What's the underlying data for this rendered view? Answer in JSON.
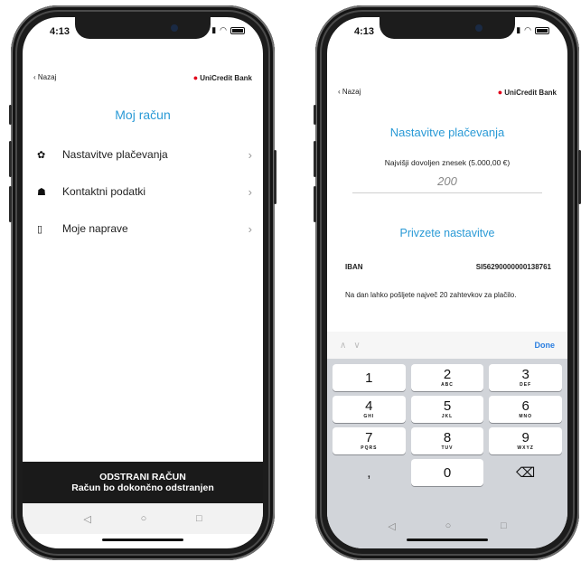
{
  "left": {
    "status_time": "4:13",
    "back": "‹ Nazaj",
    "brand": "UniCredit Bank",
    "title": "Moj račun",
    "menu": [
      {
        "label": "Nastavitve plačevanja",
        "icon": "gear-icon"
      },
      {
        "label": "Kontaktni podatki",
        "icon": "contacts-icon"
      },
      {
        "label": "Moje naprave",
        "icon": "phone-icon"
      }
    ],
    "delete_title": "ODSTRANI RAČUN",
    "delete_subtitle": "Račun bo dokončno odstranjen"
  },
  "right": {
    "status_time": "4:13",
    "back": "‹ Nazaj",
    "brand": "UniCredit Bank",
    "title": "Nastavitve plačevanja",
    "limit_label": "Najvišji dovoljen znesek (5.000,00 €)",
    "limit_value": "200",
    "section_title": "Privzete nastavitve",
    "iban_label": "IBAN",
    "iban_value": "SI56290000000138761",
    "note": "Na dan lahko pošljete največ 20 zahtevkov za plačilo.",
    "keyboard": {
      "done": "Done",
      "keys": [
        {
          "d": "1",
          "l": ""
        },
        {
          "d": "2",
          "l": "ABC"
        },
        {
          "d": "3",
          "l": "DEF"
        },
        {
          "d": "4",
          "l": "GHI"
        },
        {
          "d": "5",
          "l": "JKL"
        },
        {
          "d": "6",
          "l": "MNO"
        },
        {
          "d": "7",
          "l": "PQRS"
        },
        {
          "d": "8",
          "l": "TUV"
        },
        {
          "d": "9",
          "l": "WXYZ"
        },
        {
          "d": ",",
          "l": ""
        },
        {
          "d": "0",
          "l": ""
        },
        {
          "d": "⌫",
          "l": ""
        }
      ]
    }
  },
  "colors": {
    "accent": "#2a9ad6",
    "brand_red": "#e1001a",
    "done_blue": "#2a7ee0"
  }
}
